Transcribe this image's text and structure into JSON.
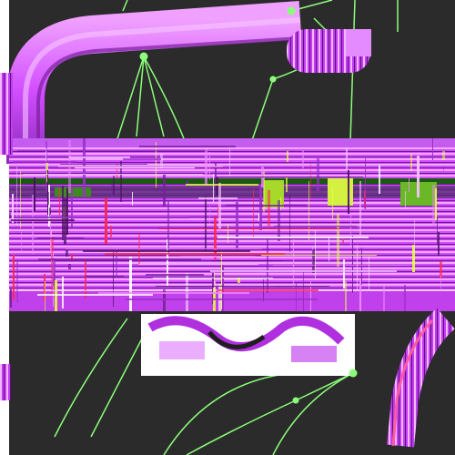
{
  "scene": {
    "description_free": true,
    "background_color": "#ffffff",
    "panel_color": "#2b2b2b",
    "accent_magenta": "#d14dff",
    "accent_magenta_light": "#f0a0ff",
    "accent_purple_dark": "#7a1fa0",
    "accent_green": "#7dff6b",
    "accent_red": "#ff2a4a",
    "accent_yellow": "#e6ff40",
    "line_color": "#8cff7a",
    "icons": [
      "glitch-band",
      "node-point",
      "connector-line"
    ]
  }
}
